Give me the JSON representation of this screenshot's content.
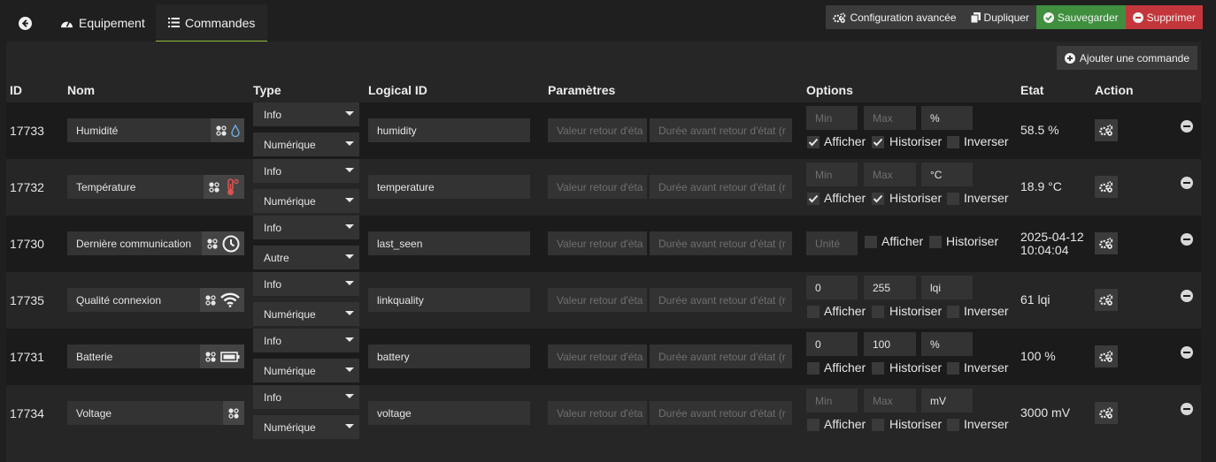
{
  "tabs": {
    "back_icon": "arrow-left-circle-icon",
    "equipement": "Equipement",
    "commandes": "Commandes"
  },
  "toolbar": {
    "config": "Configuration avancée",
    "dupliquer": "Dupliquer",
    "sauvegarder": "Sauvegarder",
    "supprimer": "Supprimer"
  },
  "add_command": "Ajouter une commande",
  "headers": {
    "id": "ID",
    "nom": "Nom",
    "type": "Type",
    "logical_id": "Logical ID",
    "parametres": "Paramètres",
    "options": "Options",
    "etat": "Etat",
    "action": "Action"
  },
  "placeholders": {
    "param1": "Valeur retour d'éta",
    "param2": "Durée avant retour d'état (r"
  },
  "labels": {
    "afficher": "Afficher",
    "historiser": "Historiser",
    "inverser": "Inverser"
  },
  "rows": [
    {
      "id": "17733",
      "name": "Humidité",
      "icon": "water-drop-icon",
      "type": "Info",
      "subtype": "Numérique",
      "logical_id": "humidity",
      "min": "Min",
      "max": "Max",
      "unit": "%",
      "min_is_ph": true,
      "max_is_ph": true,
      "unit_is_ph": false,
      "afficher": true,
      "historiser": true,
      "inverser": false,
      "etat_line1": "58.5 %",
      "etat_line2": ""
    },
    {
      "id": "17732",
      "name": "Température",
      "icon": "thermometer-icon",
      "type": "Info",
      "subtype": "Numérique",
      "logical_id": "temperature",
      "min": "Min",
      "max": "Max",
      "unit": "°C",
      "min_is_ph": true,
      "max_is_ph": true,
      "unit_is_ph": false,
      "afficher": true,
      "historiser": true,
      "inverser": false,
      "etat_line1": "18.9 °C",
      "etat_line2": ""
    },
    {
      "id": "17730",
      "name": "Dernière communication",
      "icon": "clock-icon",
      "type": "Info",
      "subtype": "Autre",
      "logical_id": "last_seen",
      "unit_only": "Unité",
      "afficher": false,
      "historiser": false,
      "etat_line1": "2025-04-12",
      "etat_line2": "10:04:04"
    },
    {
      "id": "17735",
      "name": "Qualité connexion",
      "icon": "wifi-icon",
      "type": "Info",
      "subtype": "Numérique",
      "logical_id": "linkquality",
      "min": "0",
      "max": "255",
      "unit": "lqi",
      "min_is_ph": false,
      "max_is_ph": false,
      "unit_is_ph": false,
      "afficher": false,
      "historiser": false,
      "inverser": false,
      "etat_line1": "61 lqi",
      "etat_line2": ""
    },
    {
      "id": "17731",
      "name": "Batterie",
      "icon": "battery-icon",
      "type": "Info",
      "subtype": "Numérique",
      "logical_id": "battery",
      "min": "0",
      "max": "100",
      "unit": "%",
      "min_is_ph": false,
      "max_is_ph": false,
      "unit_is_ph": false,
      "afficher": false,
      "historiser": false,
      "inverser": false,
      "etat_line1": "100 %",
      "etat_line2": ""
    },
    {
      "id": "17734",
      "name": "Voltage",
      "icon": "",
      "type": "Info",
      "subtype": "Numérique",
      "logical_id": "voltage",
      "min": "Min",
      "max": "Max",
      "unit": "mV",
      "min_is_ph": true,
      "max_is_ph": true,
      "unit_is_ph": false,
      "afficher": false,
      "historiser": false,
      "inverser": false,
      "etat_line1": "3000 mV",
      "etat_line2": ""
    }
  ],
  "colors": {
    "accent": "#8fbe3d",
    "green": "#3f8f3f",
    "red": "#c2363c"
  }
}
